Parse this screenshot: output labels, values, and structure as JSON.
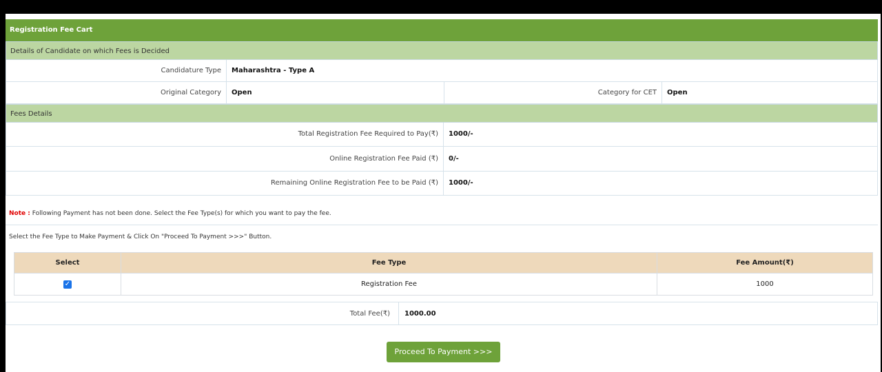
{
  "header": {
    "title": "Registration Fee Cart"
  },
  "candidate_section": {
    "title": "Details of Candidate on which Fees is Decided",
    "candidature_type_label": "Candidature Type",
    "candidature_type_value": "Maharashtra - Type A",
    "original_category_label": "Original Category",
    "original_category_value": "Open",
    "category_cet_label": "Category for CET",
    "category_cet_value": "Open"
  },
  "fees_section": {
    "title": "Fees Details",
    "total_label": "Total Registration Fee Required to Pay(₹)",
    "total_value": "1000/-",
    "paid_label": "Online Registration Fee Paid (₹)",
    "paid_value": "0/-",
    "remaining_label": "Remaining Online Registration Fee to be Paid (₹)",
    "remaining_value": "1000/-"
  },
  "note": {
    "prefix": "Note :",
    "text": " Following Payment has not been done. Select the Fee Type(s) for which you want to pay the fee."
  },
  "instruction": "Select the Fee Type to Make Payment & Click On \"Proceed To Payment >>>\" Button.",
  "fee_table": {
    "headers": {
      "select": "Select",
      "fee_type": "Fee Type",
      "amount": "Fee Amount(₹)"
    },
    "rows": [
      {
        "checked": true,
        "fee_type": "Registration Fee",
        "amount": "1000"
      }
    ]
  },
  "total_fee": {
    "label": "Total Fee(₹)",
    "value": "1000.00"
  },
  "proceed_button": {
    "label": "Proceed To Payment >>>"
  },
  "colors": {
    "header_green": "#6ea23a",
    "section_green": "#bcd6a2",
    "table_header": "#eed9bb",
    "note_red": "#e00000"
  }
}
